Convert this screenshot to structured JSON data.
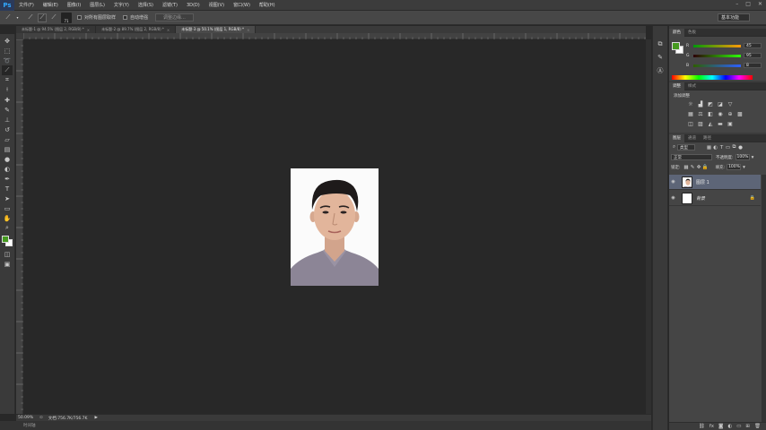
{
  "app": {
    "logo": "Ps",
    "menus": [
      "文件(F)",
      "编辑(E)",
      "图像(I)",
      "图层(L)",
      "文字(Y)",
      "选择(S)",
      "滤镜(T)",
      "3D(D)",
      "视图(V)",
      "窗口(W)",
      "帮助(H)"
    ],
    "window_controls": [
      "–",
      "□",
      "✕"
    ]
  },
  "options": {
    "brush_size": "71",
    "sample_all_layers": "对所有图层取样",
    "auto_enhance": "自动增强",
    "refine_edge": "调整边缘...",
    "workspace": "基本功能"
  },
  "tabs": [
    {
      "label": "未标题-1 @ 94.5% (图层 2, RGB/8) *",
      "close": "×"
    },
    {
      "label": "未标题-2 @ 89.7% (图层 2, RGB/8) *",
      "close": "×"
    },
    {
      "label": "未标题-3 @ 50.1% (图层 1, RGB/8) *",
      "close": "×"
    }
  ],
  "status": {
    "zoom": "50.09%",
    "doc": "文档:756.7K/756.7K",
    "bottom_label": "时间轴"
  },
  "colors": {
    "foreground": "#459a1f",
    "background": "#ffffff"
  },
  "color_panel": {
    "tabs": [
      "颜色",
      "色板"
    ],
    "r": {
      "label": "R",
      "value": "45"
    },
    "g": {
      "label": "G",
      "value": "95"
    },
    "b": {
      "label": "B",
      "value": "8"
    }
  },
  "adjust_panel": {
    "tabs": [
      "调整",
      "样式"
    ],
    "title": "添加调整"
  },
  "layers_panel": {
    "tabs": [
      "图层",
      "通道",
      "路径"
    ],
    "kind": "类型",
    "blend_mode": "正常",
    "opacity_label": "不透明度:",
    "opacity": "100%",
    "lock_label": "锁定:",
    "fill_label": "填充:",
    "fill": "100%",
    "layers": [
      {
        "name": "图层 1",
        "selected": true
      },
      {
        "name": "背景",
        "selected": false
      }
    ]
  }
}
